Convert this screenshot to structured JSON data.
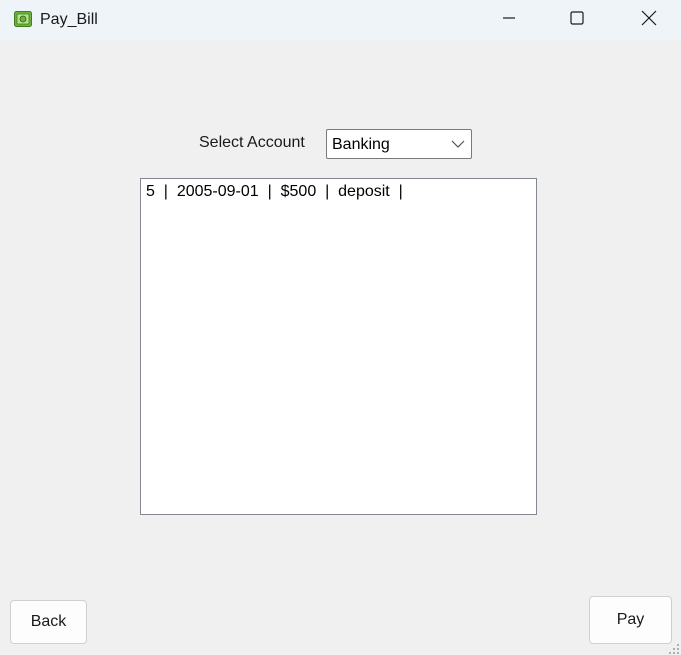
{
  "window": {
    "title": "Pay_Bill",
    "app_icon": "money-icon"
  },
  "caption_buttons": {
    "minimize_icon": "minimize-icon",
    "maximize_icon": "maximize-icon",
    "close_icon": "close-icon"
  },
  "form": {
    "select_label": "Select Account",
    "account_selected": "Banking",
    "transactions": [
      "5  |  2005-09-01  |  $500  |  deposit  |"
    ]
  },
  "buttons": {
    "back_label": "Back",
    "pay_label": "Pay"
  },
  "colors": {
    "titlebar_bg": "#eff4f9",
    "window_bg": "#f0f0f0",
    "icon_green": "#7bc043"
  }
}
